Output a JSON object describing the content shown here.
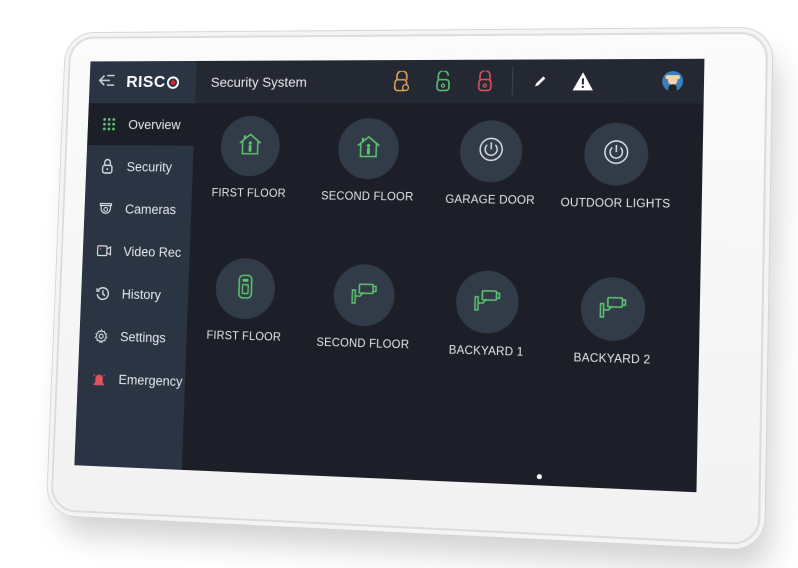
{
  "header": {
    "back_icon": "back-arrow-icon",
    "logo": "RISC",
    "title": "Security System",
    "status_icons": [
      {
        "name": "partial-lock-icon",
        "color": "#e2a25a"
      },
      {
        "name": "unlocked-icon",
        "color": "#5cc46f"
      },
      {
        "name": "locked-icon",
        "color": "#e0525e"
      }
    ],
    "actions": [
      {
        "name": "edit-icon"
      },
      {
        "name": "warning-icon"
      }
    ],
    "avatar": "user-avatar"
  },
  "sidebar": {
    "items": [
      {
        "label": "Overview",
        "icon": "grid-icon",
        "active": true
      },
      {
        "label": "Security",
        "icon": "lock-icon"
      },
      {
        "label": "Cameras",
        "icon": "dome-camera-icon"
      },
      {
        "label": "Video Rec",
        "icon": "video-rec-icon"
      },
      {
        "label": "History",
        "icon": "history-icon"
      },
      {
        "label": "Settings",
        "icon": "gear-icon"
      },
      {
        "label": "Emergency",
        "icon": "siren-icon"
      }
    ]
  },
  "tiles": [
    {
      "label": "FIRST FLOOR",
      "icon": "home-person-icon"
    },
    {
      "label": "SECOND FLOOR",
      "icon": "home-person-icon"
    },
    {
      "label": "GARAGE DOOR",
      "icon": "power-icon"
    },
    {
      "label": "OUTDOOR LIGHTS",
      "icon": "power-icon"
    },
    {
      "label": "FIRST FLOOR",
      "icon": "door-sensor-icon"
    },
    {
      "label": "SECOND FLOOR",
      "icon": "security-camera-icon"
    },
    {
      "label": "BACKYARD 1",
      "icon": "security-camera-icon"
    },
    {
      "label": "BACKYARD 2",
      "icon": "security-camera-icon"
    }
  ],
  "pagination": {
    "current_page": 1
  },
  "colors": {
    "accent_green": "#5cc46f",
    "brand_red": "#e2232b",
    "sidebar_bg": "#2a3443",
    "screen_bg": "#1c1f28"
  }
}
